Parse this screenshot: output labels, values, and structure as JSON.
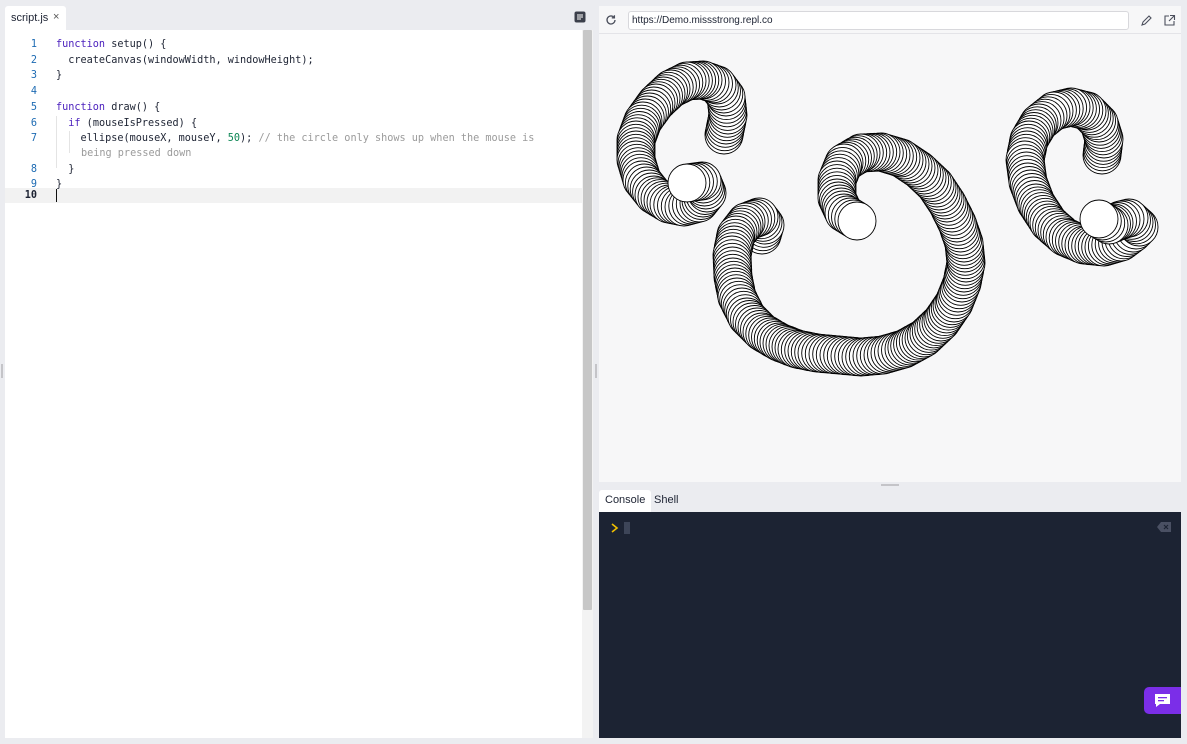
{
  "editor": {
    "file_tab": "script.js",
    "close_glyph": "×",
    "lines": [
      {
        "num": "1"
      },
      {
        "num": "2"
      },
      {
        "num": "3"
      },
      {
        "num": "4"
      },
      {
        "num": "5"
      },
      {
        "num": "6"
      },
      {
        "num": "7"
      },
      {
        "num": "8"
      },
      {
        "num": "9"
      },
      {
        "num": "10"
      }
    ],
    "code": {
      "l1a": "function",
      "l1b": " setup() {",
      "l2": "  createCanvas(windowWidth, windowHeight);",
      "l3": "}",
      "l5a": "function",
      "l5b": " draw() {",
      "l6a": "  if",
      "l6b": " (mouseIsPressed) {",
      "l7a": "    ellipse(mouseX, mouseY, ",
      "l7b": "50",
      "l7c": "); ",
      "l7d": "// the circle only shows up when the mouse is",
      "l7e": "being pressed down",
      "l8": "  }",
      "l9": "}"
    }
  },
  "preview": {
    "url": "https://Demo.missstrong.repl.co",
    "icons": {
      "reload": "reload-icon",
      "edit": "pencil-icon",
      "open": "external-link-icon"
    }
  },
  "console": {
    "tabs": [
      "Console",
      "Shell"
    ],
    "active_tab": "Console",
    "prompt_color": "#f0c000",
    "background": "#1c2333"
  },
  "chat": {
    "icon": "chat-icon",
    "color": "#7b2ee8"
  }
}
